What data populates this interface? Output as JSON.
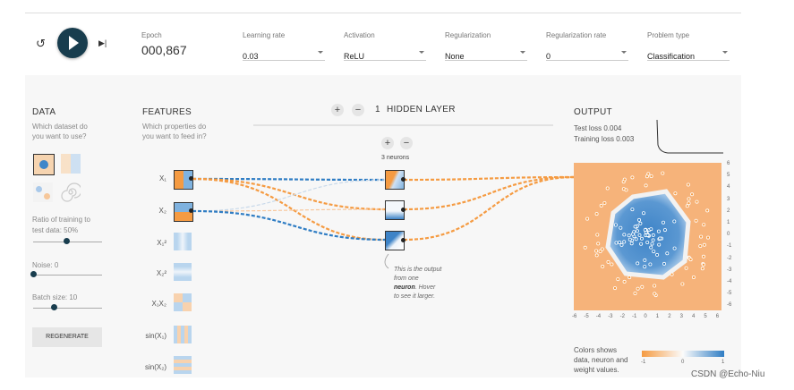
{
  "controls": {
    "epoch_label": "Epoch",
    "epoch_value": "000,867",
    "learning_rate_label": "Learning rate",
    "learning_rate_value": "0.03",
    "activation_label": "Activation",
    "activation_value": "ReLU",
    "regularization_label": "Regularization",
    "regularization_value": "None",
    "regularization_rate_label": "Regularization rate",
    "regularization_rate_value": "0",
    "problem_type_label": "Problem type",
    "problem_type_value": "Classification"
  },
  "data_panel": {
    "title": "DATA",
    "subtitle_1": "Which dataset do",
    "subtitle_2": "you want to use?",
    "ratio_label_1": "Ratio of training to",
    "ratio_label_2": "test data:  50%",
    "ratio_value": 0.5,
    "noise_label": "Noise:  0",
    "noise_value": 0,
    "batch_label": "Batch size:  10",
    "batch_value": 0.25,
    "regenerate_label": "REGENERATE"
  },
  "features_panel": {
    "title": "FEATURES",
    "subtitle_1": "Which properties do",
    "subtitle_2": "you want to feed in?",
    "features": [
      "X₁",
      "X₂",
      "X₁²",
      "X₂²",
      "X₁X₂",
      "sin(X₁)",
      "sin(X₂)"
    ]
  },
  "network": {
    "layer_count": "1",
    "hidden_layer_label": "HIDDEN LAYER",
    "neurons_label": "3 neurons",
    "tooltip_1": "This is the output",
    "tooltip_2": "from one",
    "tooltip_3": "neuron",
    "tooltip_3b": ". Hover",
    "tooltip_4": "to see it larger."
  },
  "output_panel": {
    "title": "OUTPUT",
    "test_loss": "Test loss 0.004",
    "training_loss": "Training loss 0.003",
    "legend_1": "Colors shows",
    "legend_2": "data, neuron and",
    "legend_3": "weight values.",
    "legend_ticks": [
      "-1",
      "0",
      "1"
    ],
    "y_ticks": [
      "6",
      "5",
      "4",
      "3",
      "2",
      "1",
      "0",
      "-1",
      "-2",
      "-3",
      "-4",
      "-5",
      "-6"
    ],
    "x_ticks": [
      "-6",
      "-5",
      "-4",
      "-3",
      "-2",
      "-1",
      "0",
      "1",
      "2",
      "3",
      "4",
      "5",
      "6"
    ]
  },
  "watermark": "CSDN @Echo-Niu",
  "colors": {
    "orange": "#f59b42",
    "blue": "#2f7dc4",
    "dark": "#183d4e"
  }
}
